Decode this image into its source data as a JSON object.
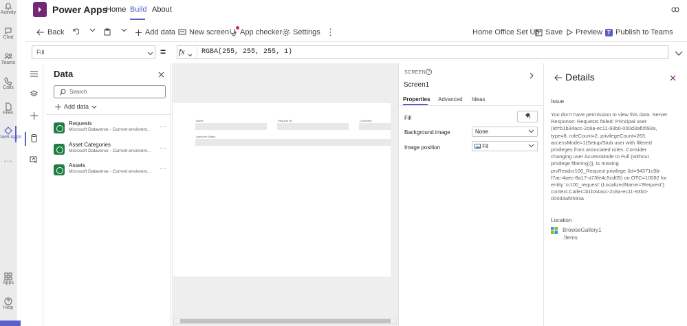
{
  "rail": {
    "items": [
      {
        "label": "Activity",
        "icon": "bell-icon"
      },
      {
        "label": "Chat",
        "icon": "chat-icon"
      },
      {
        "label": "Teams",
        "icon": "teams-icon"
      },
      {
        "label": "Calls",
        "icon": "phone-icon"
      },
      {
        "label": "Files",
        "icon": "file-icon"
      },
      {
        "label": "Power Apps",
        "icon": "power-apps-icon"
      },
      {
        "label": "...",
        "icon": "more-icon"
      }
    ],
    "bottom": [
      {
        "label": "Apps",
        "icon": "apps-icon"
      },
      {
        "label": "Help",
        "icon": "help-icon"
      }
    ]
  },
  "header": {
    "app_name": "Power Apps",
    "tabs": [
      "Home",
      "Build",
      "About"
    ],
    "active_tab": "Build"
  },
  "commands": {
    "back": "Back",
    "add_data": "Add data",
    "new_screen": "New screen",
    "app_checker": "App checker",
    "settings": "Settings",
    "app_title": "Home Office Set Up",
    "save": "Save",
    "preview": "Preview",
    "publish": "Publish to Teams"
  },
  "formula_bar": {
    "property": "Fill",
    "equals": "=",
    "fx": "fx",
    "formula": "RGBA(255, 255, 255, 1)"
  },
  "data_pane": {
    "title": "Data",
    "search_placeholder": "Search",
    "add_data": "Add data",
    "sources": [
      {
        "name": "Requests",
        "sub": "Microsoft Dataverse - Current environm..."
      },
      {
        "name": "Asset Categories",
        "sub": "Microsoft Dataverse - Current environm..."
      },
      {
        "name": "Assets",
        "sub": "Microsoft Dataverse - Current environm..."
      }
    ]
  },
  "canvas": {
    "labels": [
      "Name",
      "Request No",
      "Comment",
      "Approval Status"
    ]
  },
  "properties": {
    "kind": "SCREEN",
    "name": "Screen1",
    "tabs": [
      "Properties",
      "Advanced",
      "Ideas"
    ],
    "fill_label": "Fill",
    "background_image_label": "Background image",
    "background_image_value": "None",
    "image_position_label": "Image position",
    "image_position_value": "Fit"
  },
  "details": {
    "title": "Details",
    "issue_heading": "Issue",
    "issue_text": "You don't have permission to view this data. Server Response: Requests failed: Principal user (Id=b1b34acc-2c8a-ec11-93b0-000d3af0593a, type=8, roleCount=2, privilegeCount=263, accessMode=1(Setup/Stub user with filtered privileges from associated roles. Consider changing user AccessMode to Full (without privilege filtering))), is missing prvReadcr100_Request privilege (Id=94371c9b-f7ac-4aec-8a17-a73fe4c5cd05) on OTC=10082 for entity 'cr100_request' (LocalizedName='Request'). context.Caller=b1b34acc-2c8a-ec11-93b0-000d3af0593a",
    "location_heading": "Location",
    "location_gallery": "BrowseGallery1",
    "location_items": ".Items"
  },
  "colors": {
    "accent": "#5b5fc7",
    "power_apps": "#742774",
    "dataverse": "#1f7c44"
  }
}
